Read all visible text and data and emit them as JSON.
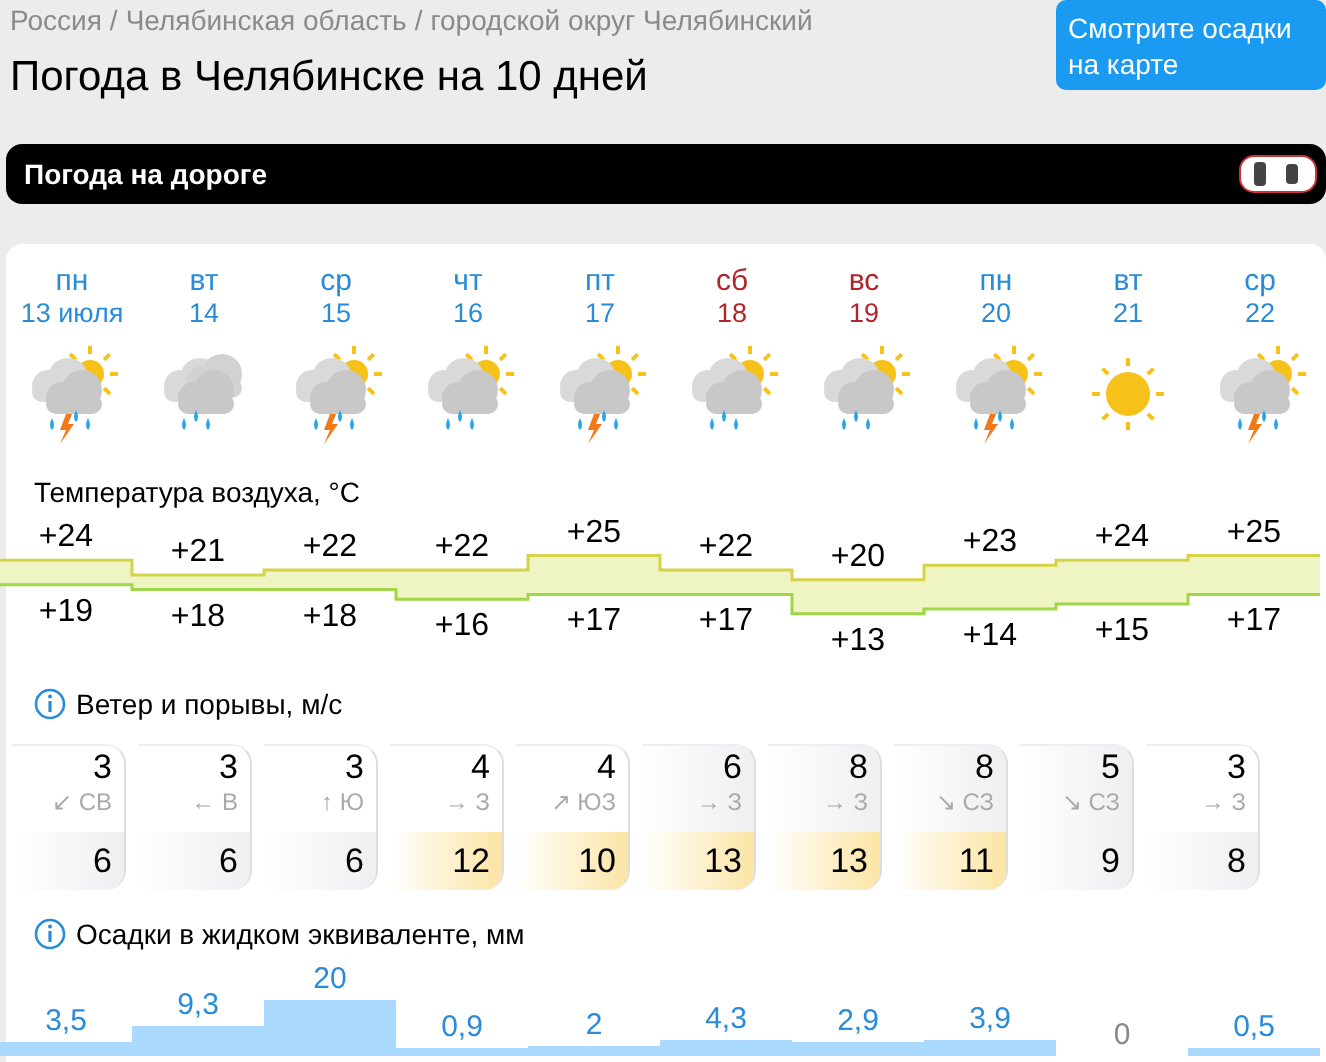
{
  "breadcrumbs": [
    "Россия",
    "Челябинская область",
    "городской округ Челябинский"
  ],
  "breadcrumb_separator": "/",
  "title": "Погода в Челябинске на 10 дней",
  "map_button": "Смотрите осадки на карте",
  "road_bar": {
    "label": "Погода на дороге"
  },
  "temperature_heading": "Температура воздуха, °C",
  "wind_heading": "Ветер и порывы, м/с",
  "precip_heading": "Осадки в жидком эквиваленте, мм",
  "days": [
    {
      "weekday": "пн",
      "date": "13 июля",
      "weekend": false,
      "sun": true,
      "cloud": true,
      "rain": true,
      "thunder": true,
      "max": "+24",
      "min": "+19",
      "wind": "3",
      "direction": "↙ СВ",
      "gust": "6",
      "strong_wind": false,
      "strong_gusts": false,
      "precip": "3,5"
    },
    {
      "weekday": "вт",
      "date": "14",
      "weekend": false,
      "sun": false,
      "cloud": true,
      "rain": true,
      "thunder": false,
      "max": "+21",
      "min": "+18",
      "wind": "3",
      "direction": "← В",
      "gust": "6",
      "strong_wind": false,
      "strong_gusts": false,
      "precip": "9,3"
    },
    {
      "weekday": "ср",
      "date": "15",
      "weekend": false,
      "sun": true,
      "cloud": true,
      "rain": true,
      "thunder": true,
      "max": "+22",
      "min": "+18",
      "wind": "3",
      "direction": "↑ Ю",
      "gust": "6",
      "strong_wind": false,
      "strong_gusts": false,
      "precip": "20"
    },
    {
      "weekday": "чт",
      "date": "16",
      "weekend": false,
      "sun": true,
      "cloud": true,
      "rain": true,
      "thunder": false,
      "max": "+22",
      "min": "+16",
      "wind": "4",
      "direction": "→ З",
      "gust": "12",
      "strong_wind": false,
      "strong_gusts": true,
      "precip": "0,9"
    },
    {
      "weekday": "пт",
      "date": "17",
      "weekend": false,
      "sun": true,
      "cloud": true,
      "rain": true,
      "thunder": true,
      "max": "+25",
      "min": "+17",
      "wind": "4",
      "direction": "↗ ЮЗ",
      "gust": "10",
      "strong_wind": false,
      "strong_gusts": true,
      "precip": "2"
    },
    {
      "weekday": "сб",
      "date": "18",
      "weekend": true,
      "sun": true,
      "cloud": true,
      "rain": true,
      "thunder": false,
      "max": "+22",
      "min": "+17",
      "wind": "6",
      "direction": "→ З",
      "gust": "13",
      "strong_wind": true,
      "strong_gusts": true,
      "precip": "4,3"
    },
    {
      "weekday": "вс",
      "date": "19",
      "weekend": true,
      "sun": true,
      "cloud": true,
      "rain": true,
      "thunder": false,
      "max": "+20",
      "min": "+13",
      "wind": "8",
      "direction": "→ З",
      "gust": "13",
      "strong_wind": true,
      "strong_gusts": true,
      "precip": "2,9"
    },
    {
      "weekday": "пн",
      "date": "20",
      "weekend": false,
      "sun": true,
      "cloud": true,
      "rain": true,
      "thunder": true,
      "max": "+23",
      "min": "+14",
      "wind": "8",
      "direction": "↘ СЗ",
      "gust": "11",
      "strong_wind": true,
      "strong_gusts": true,
      "precip": "3,9"
    },
    {
      "weekday": "вт",
      "date": "21",
      "weekend": false,
      "sun": true,
      "cloud": false,
      "rain": false,
      "thunder": false,
      "max": "+24",
      "min": "+15",
      "wind": "5",
      "direction": "↘ СЗ",
      "gust": "9",
      "strong_wind": true,
      "strong_gusts": false,
      "precip": "0"
    },
    {
      "weekday": "ср",
      "date": "22",
      "weekend": false,
      "sun": true,
      "cloud": true,
      "rain": true,
      "thunder": true,
      "max": "+25",
      "min": "+17",
      "wind": "3",
      "direction": "→ З",
      "gust": "8",
      "strong_wind": false,
      "strong_gusts": false,
      "precip": "0,5"
    }
  ]
}
